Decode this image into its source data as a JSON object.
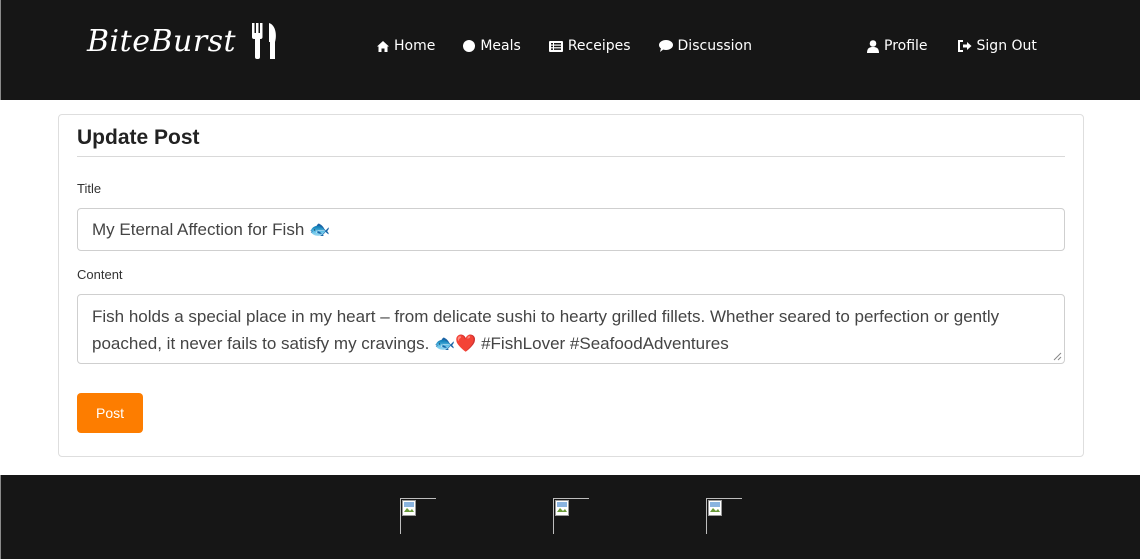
{
  "brand": {
    "name": "BiteBurst",
    "icon": "utensils-icon"
  },
  "nav": {
    "left": [
      {
        "label": "Home",
        "icon": "home-icon"
      },
      {
        "label": "Meals",
        "icon": "circle-icon"
      },
      {
        "label": "Receipes",
        "icon": "list-icon"
      },
      {
        "label": "Discussion",
        "icon": "comment-icon"
      }
    ],
    "right": [
      {
        "label": "Profile",
        "icon": "user-icon"
      },
      {
        "label": "Sign Out",
        "icon": "sign-out-icon"
      }
    ]
  },
  "form": {
    "heading": "Update Post",
    "title_label": "Title",
    "title_value": "My Eternal Affection for Fish 🐟",
    "content_label": "Content",
    "content_value": "Fish holds a special place in my heart – from delicate sushi to hearty grilled fillets. Whether seared to perfection or gently poached, it never fails to satisfy my cravings. 🐟❤️ #FishLover #SeafoodAdventures",
    "submit_label": "Post"
  },
  "footer": {
    "images": [
      "broken-image-icon",
      "broken-image-icon",
      "broken-image-icon"
    ]
  },
  "colors": {
    "navbar_bg": "#161616",
    "accent": "#fd7d00",
    "text": "#ffffff"
  }
}
